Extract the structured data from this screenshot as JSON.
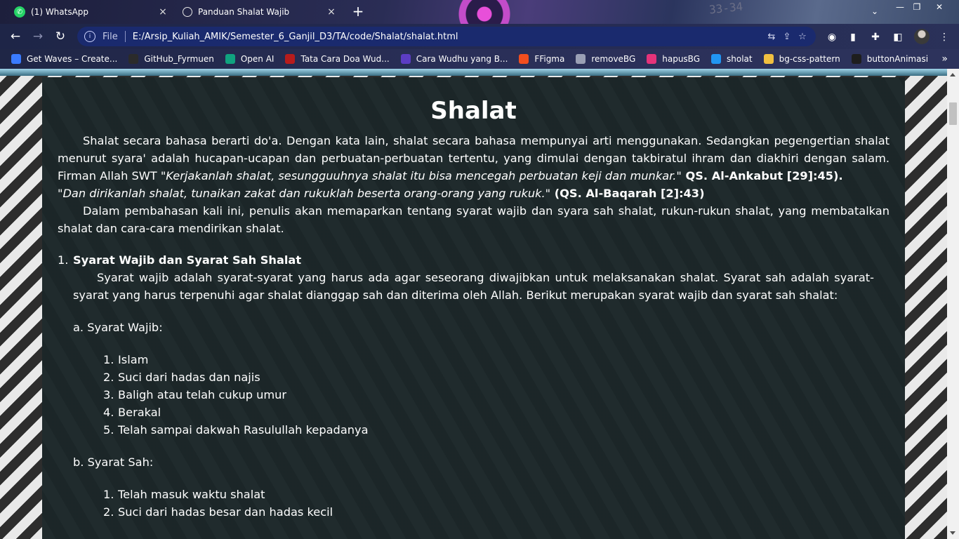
{
  "browser": {
    "tabs": [
      {
        "label": "(1) WhatsApp",
        "icon": "whatsapp-icon",
        "close": "×"
      },
      {
        "label": "Panduan Shalat Wajib",
        "icon": "globe-icon",
        "close": "×"
      }
    ],
    "new_tab": "+",
    "window_controls": [
      "⌄",
      "—",
      "❐",
      "✕"
    ],
    "decor_text": "33-34",
    "address": {
      "scheme": "File",
      "url": "E:/Arsip_Kuliah_AMIK/Semester_6_Ganjil_D3/TA/code/Shalat/shalat.html"
    },
    "bookmarks": [
      {
        "label": "Get Waves – Create...",
        "color": "#3a7bff"
      },
      {
        "label": "GitHub_Fyrmuen",
        "color": "#2b2b2b"
      },
      {
        "label": "Open AI",
        "color": "#10a37f"
      },
      {
        "label": "Tata Cara Doa Wud...",
        "color": "#b71c1c"
      },
      {
        "label": "Cara Wudhu yang B...",
        "color": "#5c3dc4"
      },
      {
        "label": "FFigma",
        "color": "#f24e1e"
      },
      {
        "label": "removeBG",
        "color": "#9aa0b5"
      },
      {
        "label": "hapusBG",
        "color": "#e5337a"
      },
      {
        "label": "sholat",
        "color": "#2196f3"
      },
      {
        "label": "bg-css-pattern",
        "color": "#f0c040"
      },
      {
        "label": "buttonAnimasi",
        "color": "#1e1e1e"
      }
    ],
    "bookmarks_more": "»"
  },
  "page": {
    "title": "Shalat",
    "intro_1": "Shalat secara bahasa berarti do'a. Dengan kata lain, shalat secara bahasa mempunyai arti menggunakan. Sedangkan pegengertian shalat menurut syara' adalah hucapan-ucapan dan perbuatan-perbuatan tertentu, yang dimulai dengan takbiratul ihram dan diakhiri dengan salam. Firman Allah SWT ",
    "quote_1": "\"Kerjakanlah shalat, sesungguuhnya shalat itu bisa mencegah perbuatan keji dan munkar.\"",
    "ref_1": " QS. Al-Ankabut [29]:45).",
    "quote_2": "\"Dan dirikanlah shalat, tunaikan zakat dan rukuklah beserta orang-orang yang rukuk.\"",
    "ref_2": " (QS. Al-Baqarah [2]:43)",
    "intro_2": "Dalam pembahasan kali ini, penulis akan memaparkan tentang syarat wajib dan syara sah shalat, rukun-rukun shalat, yang membatalkan shalat dan cara-cara mendirikan shalat.",
    "section_1": {
      "num": "1.",
      "title": "Syarat Wajib dan Syarat Sah Shalat",
      "body": "Syarat wajib adalah syarat-syarat yang harus ada agar seseorang diwajibkan untuk melaksanakan shalat. Syarat sah adalah syarat-syarat yang harus terpenuhi agar shalat dianggap sah dan diterima oleh Allah. Berikut merupakan syarat wajib dan syarat sah shalat:",
      "wajib_head": "a. Syarat Wajib:",
      "wajib_items": [
        "Islam",
        "Suci dari hadas dan najis",
        "Baligh atau telah cukup umur",
        "Berakal",
        "Telah sampai dakwah Rasulullah kepadanya"
      ],
      "sah_head": "b. Syarat Sah:",
      "sah_items": [
        "Telah masuk waktu shalat",
        "Suci dari hadas besar dan hadas kecil"
      ]
    }
  }
}
